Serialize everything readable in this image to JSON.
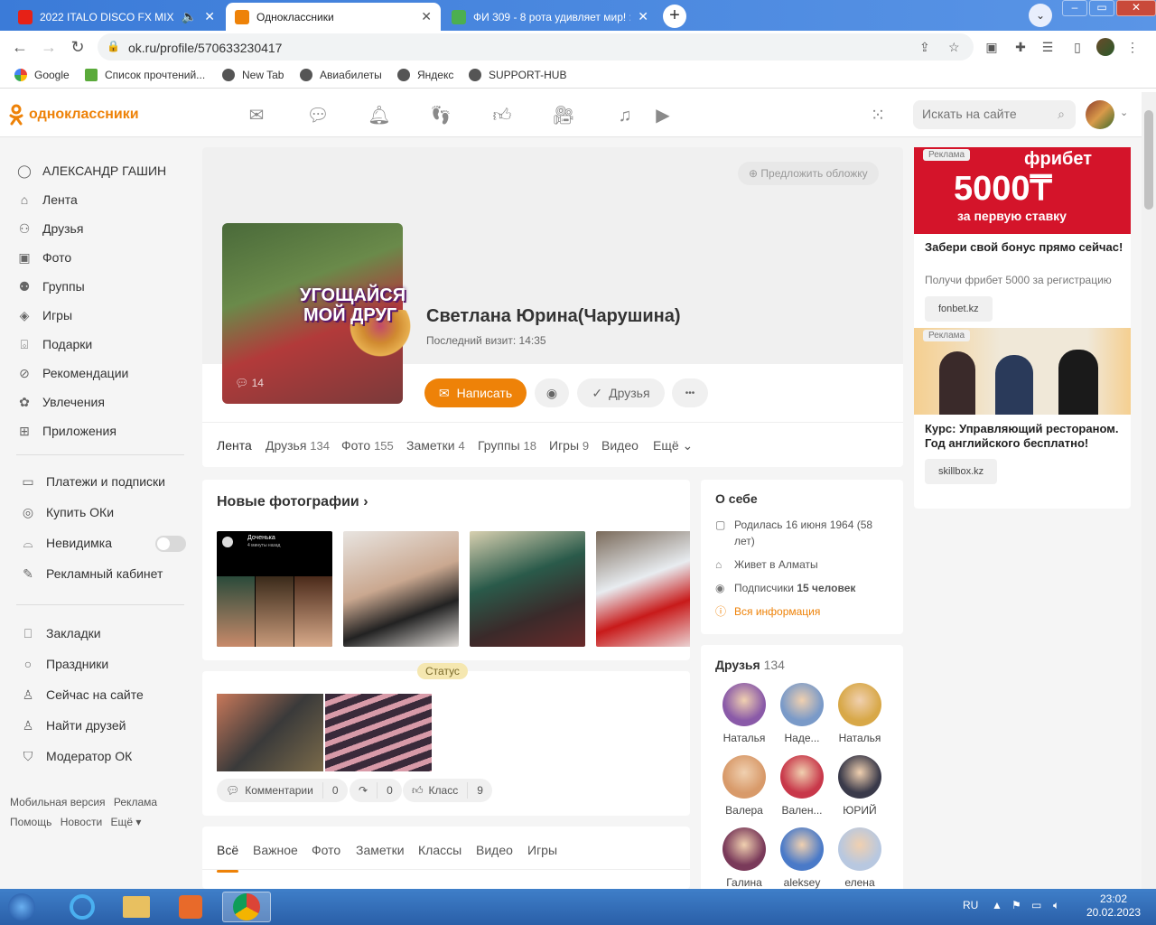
{
  "browser": {
    "tabs": [
      {
        "title": "2022 ITALO DISCO FX MIX (I",
        "fav": "#e62117"
      },
      {
        "title": "Одноклассники",
        "fav": "#ee8208"
      },
      {
        "title": "ФИ 309 - 8 рота удивляет мир! :",
        "fav": "#4caf50"
      }
    ],
    "url": "ok.ru/profile/570633230417",
    "bookmarks": [
      "Google",
      "Список прочтений...",
      "New Tab",
      "Авиабилеты",
      "Яндекс",
      "SUPPORT-HUB"
    ]
  },
  "header": {
    "logo_text": "одноклассники",
    "search_placeholder": "Искать на сайте",
    "icons": [
      "mail-icon",
      "chat-icon",
      "bell-icon",
      "guests-icon",
      "like-icon",
      "video-camera-icon",
      "music-icon",
      "video-icon",
      "apps-grid-icon"
    ]
  },
  "sidebar": {
    "user": "АЛЕКСАНДР ГАШИН",
    "main": [
      "Лента",
      "Друзья",
      "Фото",
      "Группы",
      "Игры",
      "Подарки",
      "Рекомендации",
      "Увлечения",
      "Приложения"
    ],
    "services": [
      "Платежи и подписки",
      "Купить ОКи",
      "Невидимка",
      "Рекламный кабинет"
    ],
    "extra": [
      "Закладки",
      "Праздники",
      "Сейчас на сайте",
      "Найти друзей",
      "Модератор ОК"
    ],
    "footer1": [
      "Мобильная версия",
      "Реклама"
    ],
    "footer2": [
      "Помощь",
      "Новости",
      "Ещё ▾"
    ]
  },
  "profile": {
    "cover_button": "Предложить обложку",
    "name": "Светлана Юрина(Чарушина)",
    "last_visit": "Последний визит: 14:35",
    "photo_comments": "14",
    "promo_line1": "УГОЩАЙСЯ",
    "promo_line2": "МОЙ ДРУГ",
    "write_button": "Написать",
    "friends_button": "Друзья",
    "more_button": "•••",
    "tabs": [
      {
        "label": "Лента",
        "count": ""
      },
      {
        "label": "Друзья",
        "count": "134"
      },
      {
        "label": "Фото",
        "count": "155"
      },
      {
        "label": "Заметки",
        "count": "4"
      },
      {
        "label": "Группы",
        "count": "18"
      },
      {
        "label": "Игры",
        "count": "9"
      },
      {
        "label": "Видео",
        "count": ""
      },
      {
        "label": "Ещё",
        "count": ""
      }
    ]
  },
  "photos": {
    "title": "Новые фотографии",
    "thumb1_caption": "Доченька",
    "thumb1_sub": "4 минуты назад"
  },
  "status": {
    "badge": "Статус",
    "comments_label": "Комментарии",
    "comments_count": "0",
    "shares_count": "0",
    "likes_label": "Класс",
    "likes_count": "9"
  },
  "feed_tabs": [
    "Всё",
    "Важное",
    "Фото",
    "Заметки",
    "Классы",
    "Видео",
    "Игры"
  ],
  "about": {
    "title": "О себе",
    "born": "Родилась 16 июня 1964 (58 лет)",
    "lives": "Живет в Алматы",
    "subs_prefix": "Подписчики",
    "subs_value": "15 человек",
    "all_info": "Вся информация"
  },
  "friends": {
    "title": "Друзья",
    "count": "134",
    "items": [
      {
        "name": "Наталья",
        "color": "#8a5aa8"
      },
      {
        "name": "Наде...",
        "color": "#7a9ac8"
      },
      {
        "name": "Наталья",
        "color": "#d8a848"
      },
      {
        "name": "Валера",
        "color": "#d89a6a"
      },
      {
        "name": "Вален...",
        "color": "#c8384a"
      },
      {
        "name": "ЮРИЙ",
        "color": "#3a3a4a"
      },
      {
        "name": "Галина",
        "color": "#7a3a5a"
      },
      {
        "name": "aleksey",
        "color": "#4a7ac8"
      },
      {
        "name": "елена",
        "color": "#b8c8e0"
      }
    ]
  },
  "ads": [
    {
      "label": "Реклама",
      "banner_line1": "фрибет",
      "banner_line2": "5000₸",
      "banner_line3": "за первую ставку",
      "title": "Забери свой бонус прямо сейчас!",
      "desc": "Получи фрибет 5000 за регистрацию",
      "button": "fonbet.kz"
    },
    {
      "label": "Реклама",
      "title": "Курс: Управляющий рестораном. Год английского бесплатно!",
      "button": "skillbox.kz"
    }
  ],
  "taskbar": {
    "lang": "RU",
    "time": "23:02",
    "date": "20.02.2023"
  },
  "colors": {
    "accent": "#ee8208",
    "chrome_blue": "#3b7bd8"
  }
}
